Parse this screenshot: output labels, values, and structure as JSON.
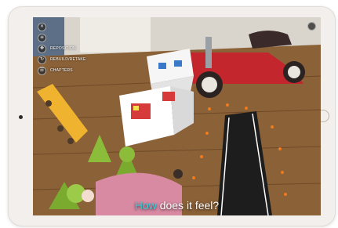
{
  "menu": {
    "items": [
      {
        "icon": "close-icon",
        "label": ""
      },
      {
        "icon": "menu-icon",
        "label": ""
      },
      {
        "icon": "reposition-icon",
        "label": "Reposition"
      },
      {
        "icon": "rebuild-icon",
        "label": "Rebuild/Retake"
      },
      {
        "icon": "chapters-icon",
        "label": "Chapters"
      }
    ]
  },
  "top_right_button": {
    "icon": "settings-icon"
  },
  "caption": {
    "highlight": "How",
    "rest": " does it feel?"
  },
  "colors": {
    "caption_highlight": "#2fd2e0",
    "wagon_red": "#c4262e",
    "floor_wood": "#8b6137"
  },
  "hardware": {
    "camera": "front-camera-icon",
    "home_button": "home-button-icon"
  }
}
